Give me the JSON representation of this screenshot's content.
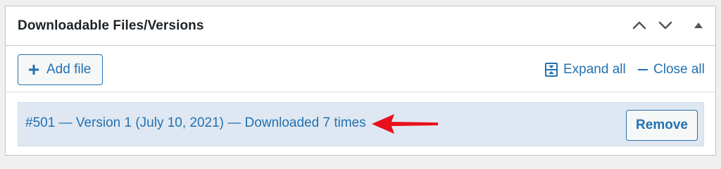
{
  "panel": {
    "title": "Downloadable Files/Versions",
    "controls": {
      "move_up_icon": "chevron-up-icon",
      "move_down_icon": "chevron-down-icon",
      "toggle_icon": "triangle-up-icon"
    }
  },
  "toolbar": {
    "add_file_label": "Add file",
    "add_file_icon": "plus-icon",
    "expand_all_label": "Expand all",
    "expand_all_icon": "expand-icon",
    "close_all_label": "Close all",
    "close_all_icon": "minus-icon"
  },
  "files": [
    {
      "title": "#501 — Version 1 (July 10, 2021) — Downloaded 7 times",
      "remove_label": "Remove"
    }
  ],
  "colors": {
    "accent": "#2271b1",
    "annotation_arrow": "#e8101a",
    "row_background": "#dfe8f2"
  }
}
